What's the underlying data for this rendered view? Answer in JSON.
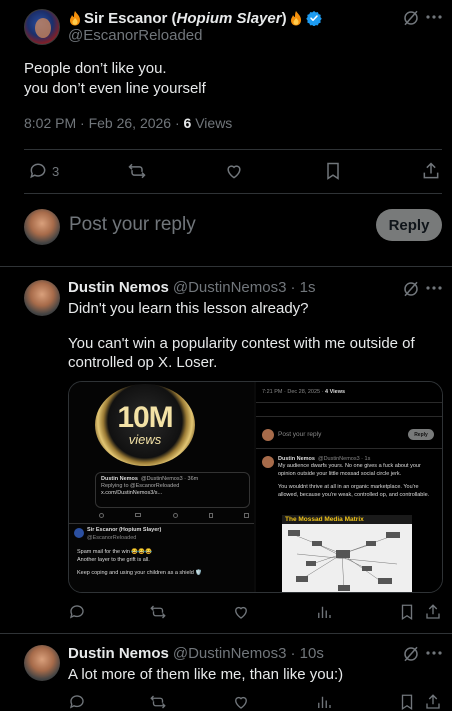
{
  "main_tweet": {
    "display_name_pre": "Sir Escanor (",
    "display_name_italic": "Hopium Slayer",
    "display_name_post": ")",
    "handle": "@EscanorReloaded",
    "text_line1": "People don’t like you.",
    "text_line2": "you don’t even line yourself",
    "time": "8:02 PM · Feb 26, 2026 · ",
    "views_count": "6",
    "views_label": " Views",
    "reply_count": "3",
    "colors": {
      "verified": "#1d9bf0",
      "flame": "#f4900c"
    }
  },
  "composer": {
    "placeholder": "Post your reply",
    "button": "Reply"
  },
  "reply1": {
    "name": "Dustin Nemos",
    "handle": "@DustinNemos3",
    "time": "· 1s",
    "line1": "Didn't you learn this lesson already?",
    "line2": "You can't win a popularity contest with me outside of",
    "line3": "controlled op X. Loser.",
    "media": {
      "badge_big": "10M",
      "badge_small": "views",
      "quote_name": "Dustin Nemos",
      "quote_handle": "@DustinNemos3 · 36m",
      "quote_replying": "Replying to @EscanorReloaded",
      "quote_link": "x.com/DustinNemos3/s...",
      "inner_name": "Sir Escanor (Hopium Slayer)",
      "inner_handle": "@EscanorReloaded",
      "inner_line1": "Spam mail for the win 😂😂😂",
      "inner_line2": "Another layer to the grift is all.",
      "inner_line3": "Keep coping and using your children as a shield 🛡️",
      "right_header": "7:21 PM · Dec 28, 2025 · ",
      "right_views": "4 Views",
      "right_placeholder": "Post your reply",
      "right_reply_btn": "Reply",
      "right_name": "Dustin Nemos",
      "right_handle": "@DustinNemos3 · 1s",
      "right_text1": "My audience dwarfs yours. No one gives a fuck about your opinion outside your little mossad social circle jerk.",
      "right_text2": "You wouldnt thrive at all in an organic marketplace. You're allowed, because you're weak, controlled op, and controllable.",
      "matrix_title": "The Mossad Media Matrix"
    }
  },
  "reply2": {
    "name": "Dustin Nemos",
    "handle": "@DustinNemos3",
    "time": "· 10s",
    "text": "A lot more of them like me, than like you:)"
  }
}
